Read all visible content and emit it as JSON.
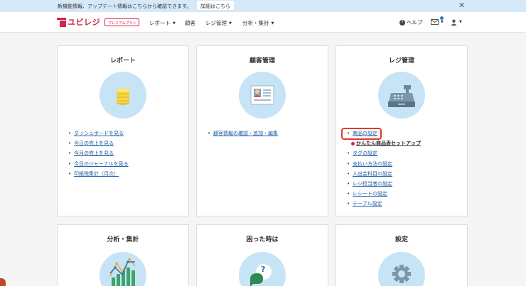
{
  "banner": {
    "text": "新機能情報、アップデート情報はこちらから確認できます。",
    "link_label": "詳細はこちら",
    "close_label": "✕"
  },
  "nav": {
    "logo_text": "ユビレジ",
    "plan_badge": "プレミアムプラン",
    "items": [
      {
        "label": "レポート"
      },
      {
        "label": "顧客"
      },
      {
        "label": "レジ管理"
      },
      {
        "label": "分析・集計"
      }
    ],
    "help_label": "ヘルプ",
    "help_icon": "?"
  },
  "cards": {
    "report": {
      "title": "レポート",
      "icon": "coins-icon",
      "links": [
        "ダッシュボードを見る",
        "今日の売上を見る",
        "今月の売上を見る",
        "今日のジャーナルを見る",
        "印紙税集計（月次）"
      ]
    },
    "customer": {
      "title": "顧客管理",
      "icon": "profile-card-icon",
      "links": [
        "顧客情報の確認・追加・編集"
      ]
    },
    "register": {
      "title": "レジ管理",
      "icon": "cash-register-icon",
      "links": [
        "商品の設定",
        "かんたん商品表セットアップ",
        "タグの設定",
        "支払い方法の設定",
        "入出金科目の設定",
        "レジ担当者の設定",
        "レシートの設定",
        "テーブル設定"
      ]
    },
    "analysis": {
      "title": "分析・集計",
      "icon": "bar-chart-icon"
    },
    "trouble": {
      "title": "困った時は",
      "icon": "question-bubble-icon",
      "icon_glyph": "?"
    },
    "settings": {
      "title": "設定",
      "icon": "gear-icon"
    }
  },
  "colors": {
    "brand": "#d0264a",
    "link": "#1f5fa5",
    "highlight": "#e03a2c",
    "banner_bg": "#d6e9f8",
    "icon_circle": "#c6e4f6"
  }
}
